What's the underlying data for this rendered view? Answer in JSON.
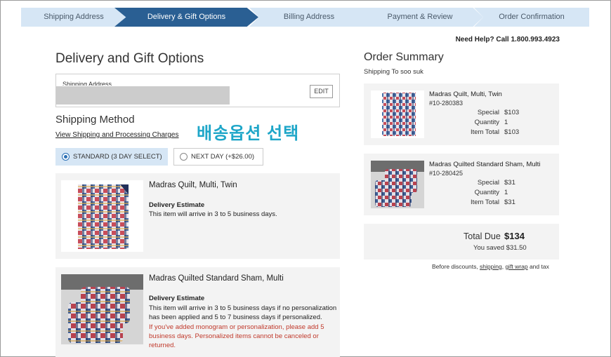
{
  "steps": [
    "Shipping Address",
    "Delivery & Gift Options",
    "Billing Address",
    "Payment & Review",
    "Order Confirmation"
  ],
  "help": "Need Help? Call 1.800.993.4923",
  "page_title": "Delivery and Gift Options",
  "shipping_address": {
    "label": "Shipping Address",
    "edit_label": "EDIT"
  },
  "shipping_method": {
    "title": "Shipping Method",
    "link": "View Shipping and Processing Charges",
    "options": [
      "STANDARD (3 DAY SELECT)",
      "NEXT DAY (+$26.00)"
    ]
  },
  "overlay_text": "배송옵션 선택",
  "items": [
    {
      "name": "Madras Quilt, Multi, Twin",
      "estimate_label": "Delivery Estimate",
      "estimate_text": "This item will arrive in 3 to 5 business days."
    },
    {
      "name": "Madras Quilted Standard Sham, Multi",
      "estimate_label": "Delivery Estimate",
      "estimate_text": "This item will arrive in 3 to 5 business days if no personalization has been applied and 5 to 7 business days if personalized.",
      "warning": "If you've added monogram or personalization, please add 5 business days. Personalized items cannot be canceled or returned."
    }
  ],
  "order_summary": {
    "title": "Order Summary",
    "ship_to": "Shipping To soo suk",
    "products": [
      {
        "name": "Madras Quilt, Multi, Twin",
        "sku": "#10-280383",
        "special_label": "Special",
        "special": "$103",
        "qty_label": "Quantity",
        "qty": "1",
        "total_label": "Item Total",
        "total": "$103"
      },
      {
        "name": "Madras Quilted Standard Sham, Multi",
        "sku": "#10-280425",
        "special_label": "Special",
        "special": "$31",
        "qty_label": "Quantity",
        "qty": "1",
        "total_label": "Item Total",
        "total": "$31"
      }
    ],
    "total_label": "Total Due",
    "total": "$134",
    "saved": "You saved $31.50",
    "disclaimer_pre": "Before discounts, ",
    "disclaimer_link1": "shipping",
    "disclaimer_mid": ", ",
    "disclaimer_link2": "gift wrap",
    "disclaimer_post": " and tax"
  }
}
